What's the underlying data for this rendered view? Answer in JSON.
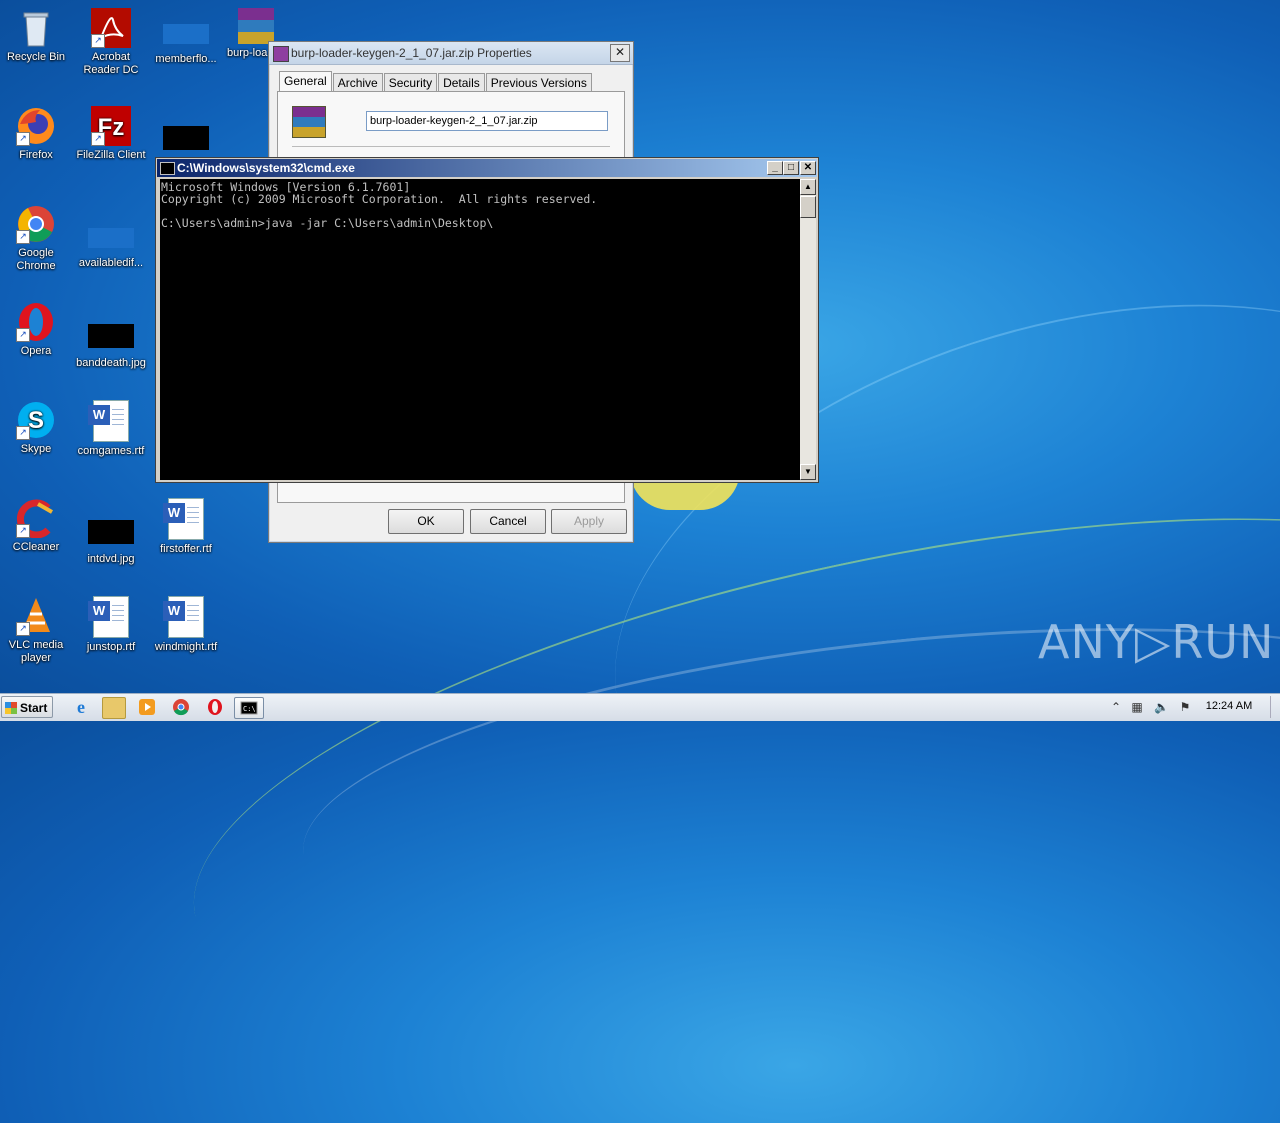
{
  "desktop": {
    "icons": [
      {
        "label": "Recycle Bin"
      },
      {
        "label": "Acrobat Reader DC"
      },
      {
        "label": "memberflo..."
      },
      {
        "label": "burp-loa"
      },
      {
        "label": "Firefox"
      },
      {
        "label": "FileZilla Client"
      },
      {
        "label": "Google Chrome"
      },
      {
        "label": "availabledif..."
      },
      {
        "label": "Opera"
      },
      {
        "label": "banddeath.jpg"
      },
      {
        "label": "Skype"
      },
      {
        "label": "comgames.rtf"
      },
      {
        "label": "CCleaner"
      },
      {
        "label": "intdvd.jpg"
      },
      {
        "label": "firstoffer.rtf"
      },
      {
        "label": "VLC media player"
      },
      {
        "label": "junstop.rtf"
      },
      {
        "label": "windmight.rtf"
      }
    ],
    "watermark": "ANY▷RUN"
  },
  "properties_dialog": {
    "title": "burp-loader-keygen-2_1_07.jar.zip Properties",
    "tabs": [
      "General",
      "Archive",
      "Security",
      "Details",
      "Previous Versions"
    ],
    "active_tab": "General",
    "filename_value": "burp-loader-keygen-2_1_07.jar.zip",
    "buttons": {
      "ok": "OK",
      "cancel": "Cancel",
      "apply": "Apply"
    }
  },
  "cmd_window": {
    "title": "C:\\Windows\\system32\\cmd.exe",
    "lines": [
      "Microsoft Windows [Version 6.1.7601]",
      "Copyright (c) 2009 Microsoft Corporation.  All rights reserved.",
      "",
      "C:\\Users\\admin>java -jar C:\\Users\\admin\\Desktop\\"
    ]
  },
  "taskbar": {
    "start_label": "Start",
    "clock": "12:24 AM"
  },
  "colors": {
    "cmd_title": "#0a246a",
    "desktop_bg": "#1d82d4",
    "console_bg": "#000000"
  }
}
